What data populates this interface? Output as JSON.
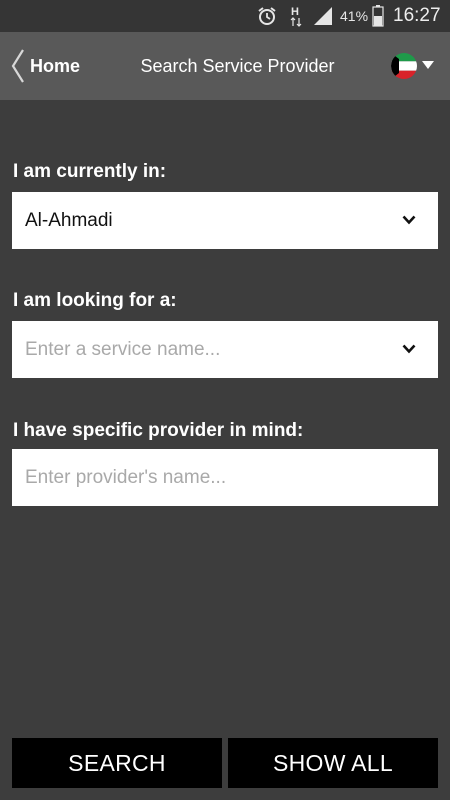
{
  "status_bar": {
    "battery_percent": "41%",
    "time": "16:27",
    "network_label": "H",
    "icons": [
      "alarm-icon",
      "network-h-icon",
      "signal-icon",
      "battery-icon"
    ]
  },
  "header": {
    "back_label": "Home",
    "title": "Search Service Provider",
    "language_flag": "kuwait-flag-icon"
  },
  "form": {
    "location": {
      "label": "I am currently in:",
      "value": "Al-Ahmadi"
    },
    "service": {
      "label": "I am looking for a:",
      "placeholder": "Enter a service name..."
    },
    "provider": {
      "label": "I have specific provider in mind:",
      "placeholder": "Enter provider's name..."
    }
  },
  "buttons": {
    "search_label": "SEARCH",
    "show_all_label": "SHOW ALL"
  },
  "colors": {
    "background": "#3d3d3d",
    "header_bg": "#595959",
    "button_bg": "#000000"
  }
}
